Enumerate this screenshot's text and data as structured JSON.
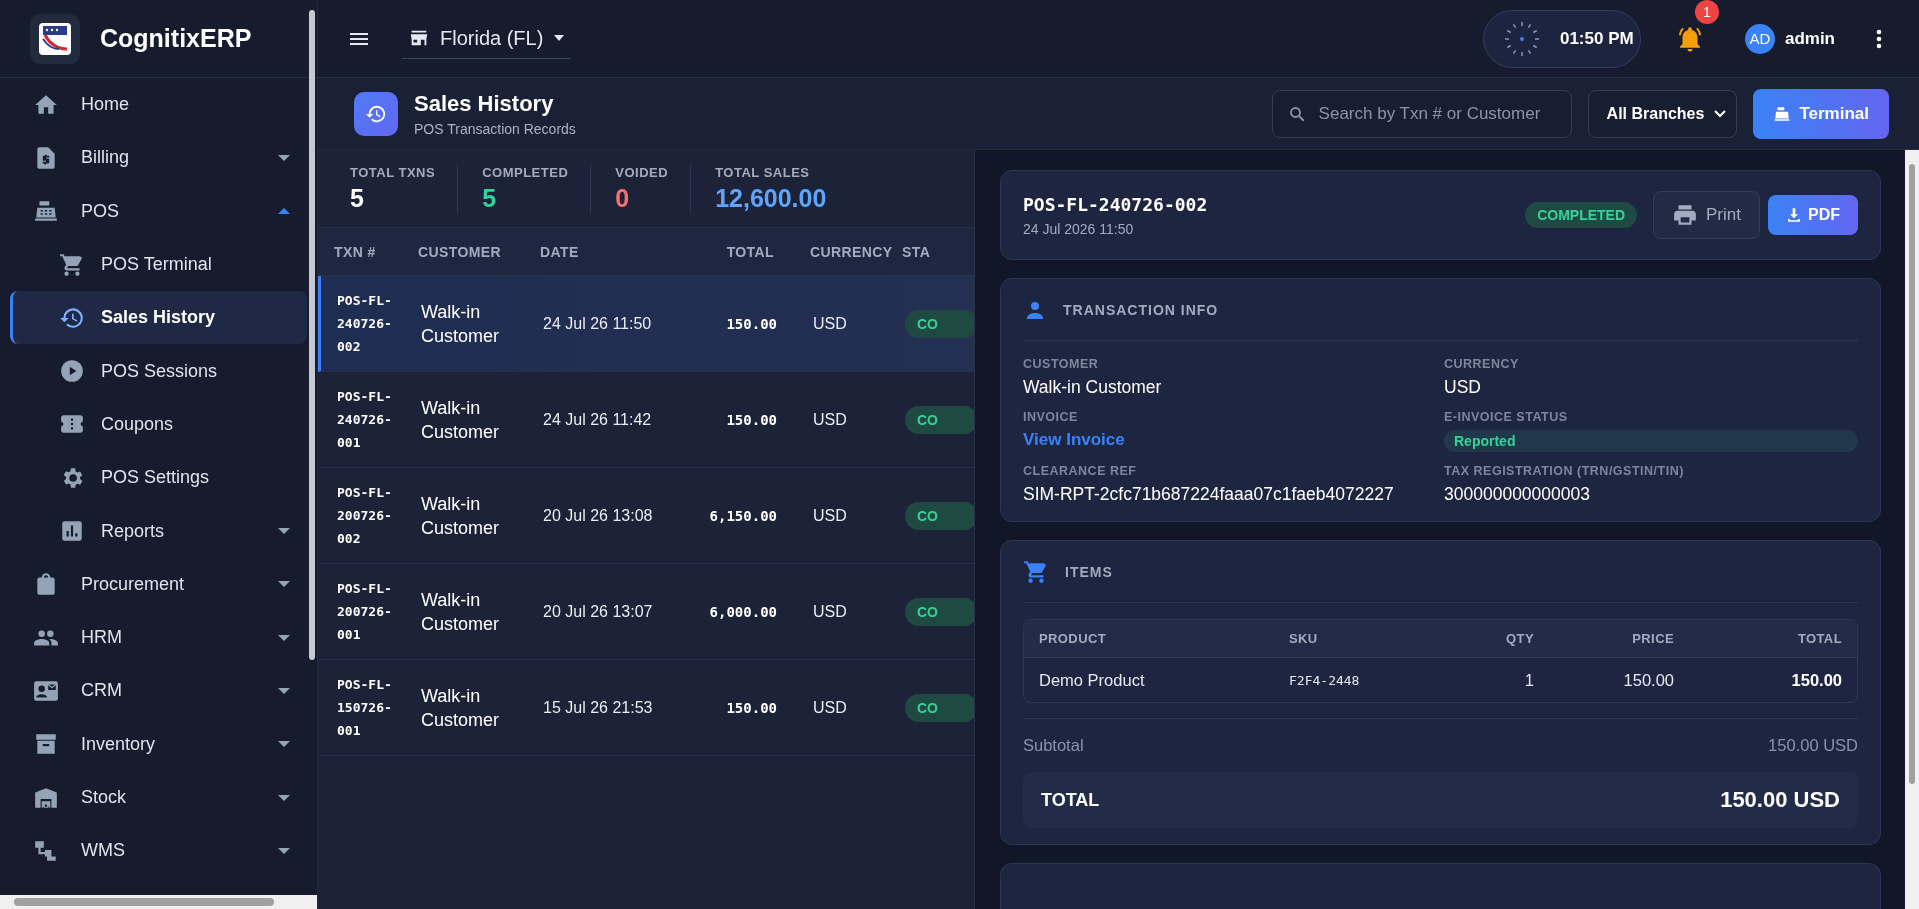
{
  "sidebar": {
    "brand": "CognitixERP",
    "items": [
      {
        "label": "Home",
        "kind": "link",
        "selected": false
      },
      {
        "label": "Billing",
        "kind": "group",
        "expanded": false,
        "selected": false
      },
      {
        "label": "POS",
        "kind": "group",
        "expanded": true,
        "selected": false,
        "children": [
          {
            "label": "POS Terminal",
            "kind": "link",
            "selected": false
          },
          {
            "label": "Sales History",
            "kind": "link",
            "selected": true
          },
          {
            "label": "POS Sessions",
            "kind": "link",
            "selected": false
          },
          {
            "label": "Coupons",
            "kind": "link",
            "selected": false
          },
          {
            "label": "POS Settings",
            "kind": "link",
            "selected": false
          },
          {
            "label": "Reports",
            "kind": "group",
            "expanded": false,
            "selected": false
          }
        ]
      },
      {
        "label": "Procurement",
        "kind": "group",
        "expanded": false,
        "selected": false
      },
      {
        "label": "HRM",
        "kind": "group",
        "expanded": false,
        "selected": false
      },
      {
        "label": "CRM",
        "kind": "group",
        "expanded": false,
        "selected": false
      },
      {
        "label": "Inventory",
        "kind": "group",
        "expanded": false,
        "selected": false
      },
      {
        "label": "Stock",
        "kind": "group",
        "expanded": false,
        "selected": false
      },
      {
        "label": "WMS",
        "kind": "group",
        "expanded": false,
        "selected": false
      }
    ]
  },
  "topbar": {
    "branch": "Florida (FL)",
    "time": "01:50 PM",
    "notifications": "1",
    "user_initials": "AD",
    "user_name": "admin"
  },
  "page_header": {
    "title": "Sales History",
    "subtitle": "POS Transaction Records",
    "search": {
      "placeholder": "Search by Txn # or Customer"
    },
    "branch_filter": "All Branches",
    "terminal_button": "Terminal"
  },
  "stats": [
    {
      "label": "TOTAL TXNS",
      "value": "5",
      "color": "#ffffff"
    },
    {
      "label": "COMPLETED",
      "value": "5",
      "color": "#34d399"
    },
    {
      "label": "VOIDED",
      "value": "0",
      "color": "#f87171"
    },
    {
      "label": "TOTAL SALES",
      "value": "12,600.00",
      "color": "#60a5fa"
    }
  ],
  "table": {
    "columns": [
      "TXN #",
      "CUSTOMER",
      "DATE",
      "TOTAL",
      "CURRENCY",
      "STA"
    ],
    "rows": [
      {
        "txn": "POS-FL-240726-002",
        "customer": "Walk-in Customer",
        "date": "24 Jul 26 11:50",
        "total": "150.00",
        "currency": "USD",
        "status": "CO",
        "selected": true
      },
      {
        "txn": "POS-FL-240726-001",
        "customer": "Walk-in Customer",
        "date": "24 Jul 26 11:42",
        "total": "150.00",
        "currency": "USD",
        "status": "CO",
        "selected": false
      },
      {
        "txn": "POS-FL-200726-002",
        "customer": "Walk-in Customer",
        "date": "20 Jul 26 13:08",
        "total": "6,150.00",
        "currency": "USD",
        "status": "CO",
        "selected": false
      },
      {
        "txn": "POS-FL-200726-001",
        "customer": "Walk-in Customer",
        "date": "20 Jul 26 13:07",
        "total": "6,000.00",
        "currency": "USD",
        "status": "CO",
        "selected": false
      },
      {
        "txn": "POS-FL-150726-001",
        "customer": "Walk-in Customer",
        "date": "15 Jul 26 21:53",
        "total": "150.00",
        "currency": "USD",
        "status": "CO",
        "selected": false
      }
    ]
  },
  "detail": {
    "txn": "POS-FL-240726-002",
    "date": "24 Jul 2026 11:50",
    "status": "COMPLETED",
    "print_button": "Print",
    "pdf_button": "PDF",
    "info": {
      "title": "TRANSACTION INFO",
      "fields": [
        {
          "label": "CUSTOMER",
          "value": "Walk-in Customer",
          "kind": "text"
        },
        {
          "label": "CURRENCY",
          "value": "USD",
          "kind": "text"
        },
        {
          "label": "INVOICE",
          "value": "View Invoice",
          "kind": "link"
        },
        {
          "label": "E-INVOICE STATUS",
          "value": "Reported",
          "kind": "badge"
        },
        {
          "label": "CLEARANCE REF",
          "value": "SIM-RPT-2cfc71b687224faaa07c1faeb4072227",
          "kind": "text"
        },
        {
          "label": "TAX REGISTRATION (TRN/GSTIN/TIN)",
          "value": "300000000000003",
          "kind": "text"
        }
      ]
    },
    "items": {
      "title": "ITEMS",
      "columns": [
        "PRODUCT",
        "SKU",
        "QTY",
        "PRICE",
        "TOTAL"
      ],
      "rows": [
        {
          "product": "Demo Product",
          "sku": "F2F4-2448",
          "qty": "1",
          "price": "150.00",
          "total": "150.00"
        }
      ],
      "subtotal_label": "Subtotal",
      "subtotal": "150.00 USD",
      "total_label": "TOTAL",
      "total": "150.00 USD"
    }
  }
}
